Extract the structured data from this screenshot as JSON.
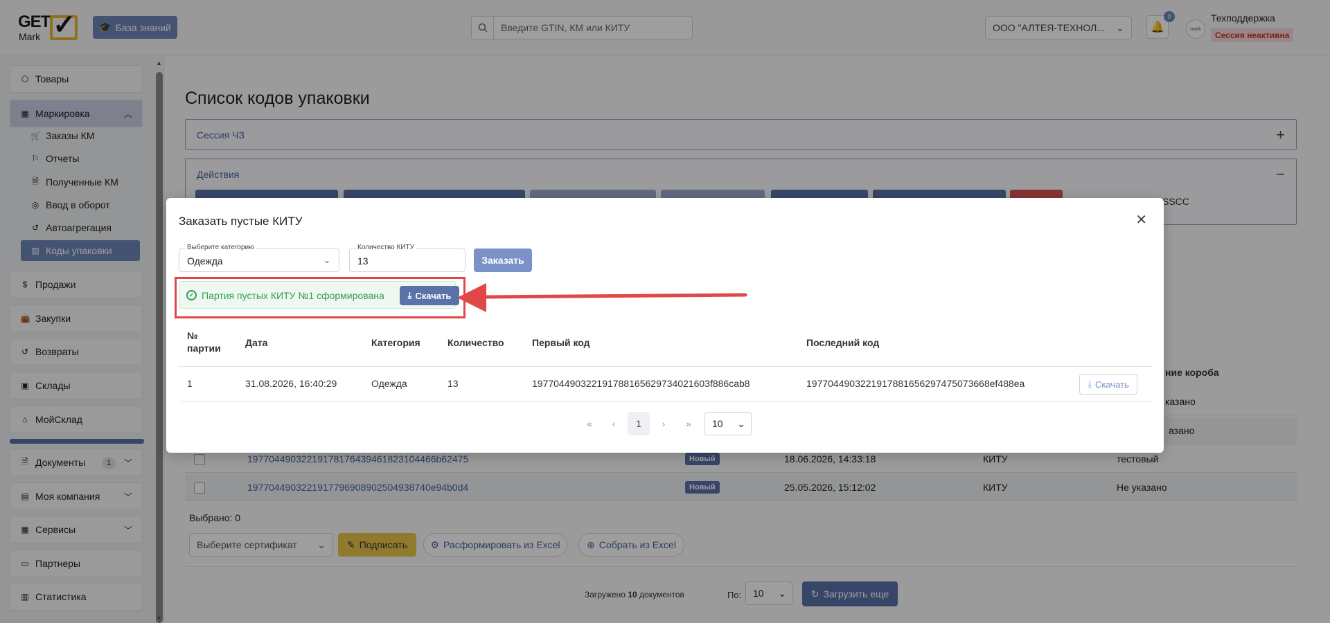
{
  "header": {
    "logo_top": "GET",
    "logo_bottom": "Mark",
    "knowledge_base_label": "База знаний",
    "search_placeholder": "Введите GTIN, КМ или КИТУ",
    "org_name": "ООО \"АЛТЕЯ-ТЕХНОЛ...",
    "notifications_count": "0",
    "avatar_text": "mark",
    "user_name": "Техподдержка",
    "session_status": "Сессия неактивна"
  },
  "sidebar": {
    "items": [
      {
        "label": "Товары",
        "icon": "cube-icon"
      },
      {
        "label": "Маркировка",
        "icon": "grid-icon"
      },
      {
        "label": "Продажи",
        "icon": "dollar-icon"
      },
      {
        "label": "Закупки",
        "icon": "bag-icon"
      },
      {
        "label": "Возвраты",
        "icon": "return-icon"
      },
      {
        "label": "Склады",
        "icon": "warehouse-icon"
      },
      {
        "label": "МойСклад",
        "icon": "home-icon"
      },
      {
        "label": "Документы",
        "icon": "document-icon",
        "badge": "1"
      },
      {
        "label": "Моя компания",
        "icon": "briefcase-icon"
      },
      {
        "label": "Сервисы",
        "icon": "grid-icon"
      },
      {
        "label": "Партнеры",
        "icon": "partners-icon"
      },
      {
        "label": "Статистика",
        "icon": "chart-icon"
      }
    ],
    "sub_items": [
      {
        "label": "Заказы КМ",
        "icon": "cart-icon"
      },
      {
        "label": "Отчеты",
        "icon": "flag-icon"
      },
      {
        "label": "Полученные КМ",
        "icon": "file-icon"
      },
      {
        "label": "Ввод в оборот",
        "icon": "check-circle-icon"
      },
      {
        "label": "Автоагрегация",
        "icon": "history-icon"
      },
      {
        "label": "Коды упаковки",
        "icon": "barcode-icon"
      }
    ]
  },
  "main": {
    "title": "Список кодов упаковки",
    "session_panel": "Сессия ЧЗ",
    "actions_panel": "Действия",
    "sscc_fragment": "SSCC",
    "column_fragment": "ние короба",
    "bg_rows": [
      {
        "code": "",
        "status": "",
        "date": "",
        "type": "",
        "note": "казано"
      },
      {
        "code": "",
        "status": "",
        "date": "",
        "type": "",
        "note": "азано"
      },
      {
        "code": "197704490322191781764394618231044​66b62475",
        "status": "Новый",
        "date": "18.06.2026, 14:33:18",
        "type": "КИТУ",
        "note": "тестовый"
      },
      {
        "code": "197704490322191779690890250493874​0e94b0d4",
        "status": "Новый",
        "date": "25.05.2026, 15:12:02",
        "type": "КИТУ",
        "note": "Не указано"
      }
    ],
    "selected_label": "Выбрано: 0",
    "cert_placeholder": "Выберите сертификат",
    "sign_label": "Подписать",
    "disband_label": "Расформировать из Excel",
    "assemble_label": "Собрать из Excel",
    "loaded_prefix": "Загружено",
    "loaded_count": "10",
    "loaded_suffix": "документов",
    "per_page_label": "По:",
    "per_page_value": "10",
    "load_more_label": "Загрузить еще"
  },
  "modal": {
    "title": "Заказать пустые КИТУ",
    "category_label": "Выберите категорию",
    "category_value": "Одежда",
    "quantity_label": "Количество КИТУ",
    "quantity_value": "13",
    "order_label": "Заказать",
    "success_message": "Партия пустых КИТУ №1 сформирована",
    "download_label": "Скачать",
    "columns": [
      "№ партии",
      "Дата",
      "Категория",
      "Количество",
      "Первый код",
      "Последний код"
    ],
    "rows": [
      {
        "batch": "1",
        "date": "31.08.2026, 16:40:29",
        "category": "Одежда",
        "quantity": "13",
        "first_code": "197704490322191788165629734021603f886cab8",
        "last_code": "197704490322191788165629747507366​8ef488ea",
        "download": "Скачать"
      }
    ],
    "pagination": {
      "first": "«",
      "prev": "‹",
      "current": "1",
      "next": "›",
      "last": "»",
      "page_size": "10"
    }
  },
  "colors": {
    "accent": "#5a72a8",
    "success": "#2e9e4f",
    "annotation": "#e04848",
    "warning_btn": "#e8c64a"
  }
}
